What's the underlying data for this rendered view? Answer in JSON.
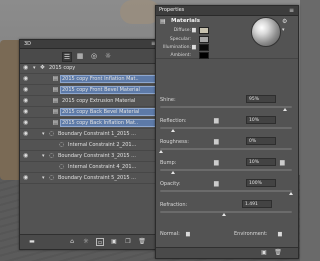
{
  "layers_panel": {
    "title": "3D",
    "menu": "≡",
    "rows": [
      {
        "label": "2015 copy",
        "eye": true
      },
      {
        "label": "2015 copy Front Inflation Mat..",
        "eye": true,
        "selected": true
      },
      {
        "label": "2015 copy Front Bevel Material",
        "eye": true,
        "selected": true
      },
      {
        "label": "2015 copy Extrusion Material",
        "eye": true
      },
      {
        "label": "2015 copy Back Bevel Material",
        "eye": true,
        "selected": true
      },
      {
        "label": "2015 copy Back Inflation Mat..",
        "eye": true,
        "selected": true
      },
      {
        "label": "Boundary Constraint 1_2015 ...",
        "eye": true
      },
      {
        "label": "Internal Constraint 2_201...",
        "eye": false
      },
      {
        "label": "Boundary Constraint 3_2015 ...",
        "eye": true
      },
      {
        "label": "Internal Constraint 4_201...",
        "eye": false
      },
      {
        "label": "Boundary Constraint 5_2015 ...",
        "eye": true
      }
    ]
  },
  "properties": {
    "title": "Properties",
    "menu": "≡",
    "section": "Materials",
    "diffuse_label": "Diffuse:",
    "specular_label": "Specular:",
    "illumination_label": "Illumination:",
    "ambient_label": "Ambient:",
    "fields": [
      {
        "label": "Shine:",
        "value": "95%",
        "pct": 0.95
      },
      {
        "label": "Reflection:",
        "value": "10%",
        "pct": 0.1
      },
      {
        "label": "Roughness:",
        "value": "0%",
        "pct": 0.0
      },
      {
        "label": "Bump:",
        "value": "10%",
        "pct": 0.1
      },
      {
        "label": "Opacity:",
        "value": "100%",
        "pct": 1.0
      },
      {
        "label": "Refraction:",
        "value": "1.491",
        "pct": 0.49
      }
    ],
    "normal_label": "Normal:",
    "environment_label": "Environment:"
  },
  "colors": {
    "diffuse": "#c8c3b0",
    "specular": "#a6a6a6",
    "illumination": "#0a0a0a",
    "ambient": "#000000",
    "selected_row": "#5d7aa8"
  }
}
